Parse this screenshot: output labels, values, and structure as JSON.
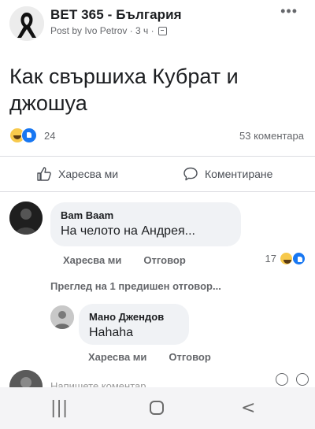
{
  "post": {
    "page_name": "BET 365 - България",
    "meta": "Post by Ivo Petrov · 3 ч ·",
    "text": "Как свършиха Кубрат и джошуа",
    "reaction_count": "24",
    "comment_count": "53 коментара"
  },
  "actions": {
    "like": "Харесва ми",
    "comment": "Коментиране"
  },
  "comments": [
    {
      "author": "Bam Baam",
      "text": "На челото на Андрея...",
      "like_label": "Харесва ми",
      "reply_label": "Отговор",
      "reactions": "17"
    },
    {
      "author": "Мано Джендов",
      "text": "Hahaha",
      "like_label": "Харесва ми",
      "reply_label": "Отговор"
    }
  ],
  "view_previous_replies": "Преглед на 1 предишен отговор...",
  "write_comment_placeholder": "Напишете коментар...",
  "icons": {
    "more": "more-icon",
    "globe": "globe-icon",
    "like": "thumbs-up-icon",
    "comment": "speech-bubble-icon",
    "reactions": [
      "haha-icon",
      "like-icon"
    ]
  },
  "colors": {
    "facebook_blue": "#1877f2",
    "haha_yellow": "#f7c94c",
    "muted_text": "#65676b",
    "bubble_bg": "#f0f2f5"
  }
}
